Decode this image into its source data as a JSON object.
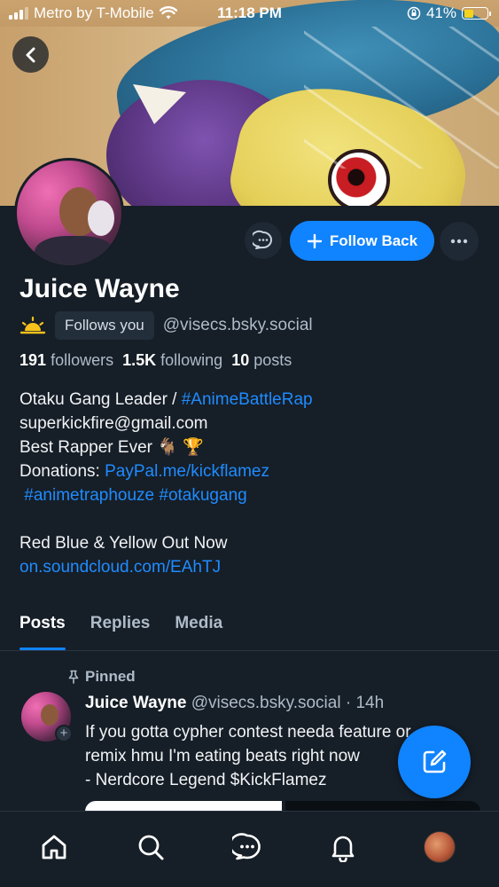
{
  "status_bar": {
    "carrier": "Metro by T-Mobile",
    "time": "11:18 PM",
    "battery": "41%",
    "battery_level": 0.41,
    "battery_color": "#f5d31c"
  },
  "header": {
    "back_icon": "chevron-left-icon"
  },
  "profile": {
    "display_name": "Juice Wayne",
    "status_emoji_icon": "sun-icon",
    "follows_you_label": "Follows you",
    "handle": "@visecs.bsky.social",
    "stats": {
      "followers_count": "191",
      "followers_label": "followers",
      "following_count": "1.5K",
      "following_label": "following",
      "posts_count": "10",
      "posts_label": "posts"
    },
    "bio": {
      "line1_text": "Otaku Gang Leader / ",
      "line1_link": "#AnimeBattleRap",
      "line2": "superkickfire@gmail.com",
      "line3": "Best Rapper Ever ",
      "line3_emoji": "🐐 🏆",
      "line4_text": "Donations: ",
      "line4_link": "PayPal.me/kickflamez",
      "line5_link1": "#animetraphouze",
      "line5_link2": "#otakugang",
      "line6": "Red Blue & Yellow Out Now",
      "line7_link": "on.soundcloud.com/EAhTJ"
    }
  },
  "actions": {
    "message_icon": "chat-bubble-icon",
    "follow_back_label": "Follow Back",
    "follow_icon": "plus-icon",
    "more_icon": "ellipsis-icon"
  },
  "tabs": [
    {
      "label": "Posts",
      "active": true
    },
    {
      "label": "Replies",
      "active": false
    },
    {
      "label": "Media",
      "active": false
    }
  ],
  "post": {
    "pinned_label": "Pinned",
    "author": "Juice Wayne",
    "handle": "@visecs.bsky.social",
    "separator": " · ",
    "time": "14h",
    "lines": [
      "If you gotta cypher contest needa feature or",
      "remix hmu I'm eating beats right now",
      "- Nerdcore Legend $KickFlamez"
    ]
  },
  "colors": {
    "accent": "#1083fe",
    "link": "#1f8cff",
    "background": "#161e27"
  },
  "bottom_nav": [
    {
      "name": "home-icon"
    },
    {
      "name": "search-icon"
    },
    {
      "name": "chat-icon"
    },
    {
      "name": "bell-icon"
    },
    {
      "name": "profile-avatar"
    }
  ]
}
